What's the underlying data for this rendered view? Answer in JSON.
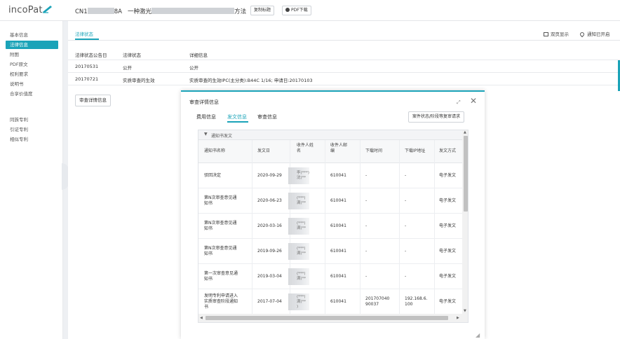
{
  "header": {
    "logo": "incoPat",
    "patent_prefix": "CN1",
    "patent_mid": "8A",
    "title_prefix": "一种激光",
    "title_suffix": "方法",
    "copy_btn": "复制标题",
    "pdf_btn": "PDF下载",
    "brand_color": "#1aa3b8"
  },
  "sidebar": {
    "items": [
      "基本信息",
      "法律信息",
      "附图",
      "PDF原文",
      "权利要求",
      "说明书",
      "合享价值度"
    ],
    "active_index": 1,
    "items2": [
      "同族专利",
      "引证专利",
      "相似专利"
    ]
  },
  "main": {
    "tab": "法律状态",
    "tools": {
      "dual_page": "双页显示",
      "notice": "通知已开启"
    },
    "legal_table": {
      "headers": [
        "法律状态公告日",
        "法律状态",
        "详细信息"
      ],
      "rows": [
        [
          "20170531",
          "公开",
          "公开"
        ],
        [
          "20170721",
          "实质审查的生效",
          "实质审查的生效IPC(主分类):B44C 1/16; 申请日:20170103"
        ]
      ]
    },
    "review_btn": "审查详情信息"
  },
  "modal": {
    "title": "审查详情信息",
    "tabs": [
      "费用信息",
      "发文信息",
      "审查信息"
    ],
    "active_tab": 1,
    "request_btn": "案件状态/阶段等复审请求",
    "section_title": "通知书发文",
    "columns": [
      "通知书名称",
      "发文日",
      "收件人姓名",
      "收件人邮编",
      "下载时间",
      "下载IP地址",
      "发文方式"
    ],
    "rows": [
      {
        "name": [
          "驳回决定"
        ],
        "date": "2020-09-29",
        "recipient": [
          "李(***)",
          "沈(**"
        ],
        "zip": "610041",
        "dl_time": [
          "-"
        ],
        "dl_ip": [
          "-"
        ],
        "method": "电子发文"
      },
      {
        "name": [
          "第N次审查意见通",
          "知书"
        ],
        "date": "2020-06-23",
        "recipient": [
          "(***)",
          "满(**"
        ],
        "zip": "610041",
        "dl_time": [
          "-"
        ],
        "dl_ip": [
          "-"
        ],
        "method": "电子发文"
      },
      {
        "name": [
          "第N次审查意见通",
          "知书"
        ],
        "date": "2020-03-16",
        "recipient": [
          "(***)",
          "满(**"
        ],
        "zip": "610041",
        "dl_time": [
          "-"
        ],
        "dl_ip": [
          "-"
        ],
        "method": "电子发文"
      },
      {
        "name": [
          "第N次审查意见通",
          "知书"
        ],
        "date": "2019-09-26",
        "recipient": [
          "(***)",
          "满(**"
        ],
        "zip": "610041",
        "dl_time": [
          "-"
        ],
        "dl_ip": [
          "-"
        ],
        "method": "电子发文"
      },
      {
        "name": [
          "第一次审查意见通",
          "知书"
        ],
        "date": "2019-03-04",
        "recipient": [
          "(***)",
          "满(**"
        ],
        "zip": "610041",
        "dl_time": [
          "-"
        ],
        "dl_ip": [
          "-"
        ],
        "method": "电子发文"
      },
      {
        "name": [
          "发明专利申请进入",
          "实质审查阶段通知",
          "书"
        ],
        "date": "2017-07-04",
        "recipient": [
          "(***)",
          "满(**",
          ")"
        ],
        "zip": "610041",
        "dl_time": [
          "201707040",
          "90037"
        ],
        "dl_ip": [
          "192.168.6.",
          "100"
        ],
        "method": "电子发文"
      }
    ]
  }
}
